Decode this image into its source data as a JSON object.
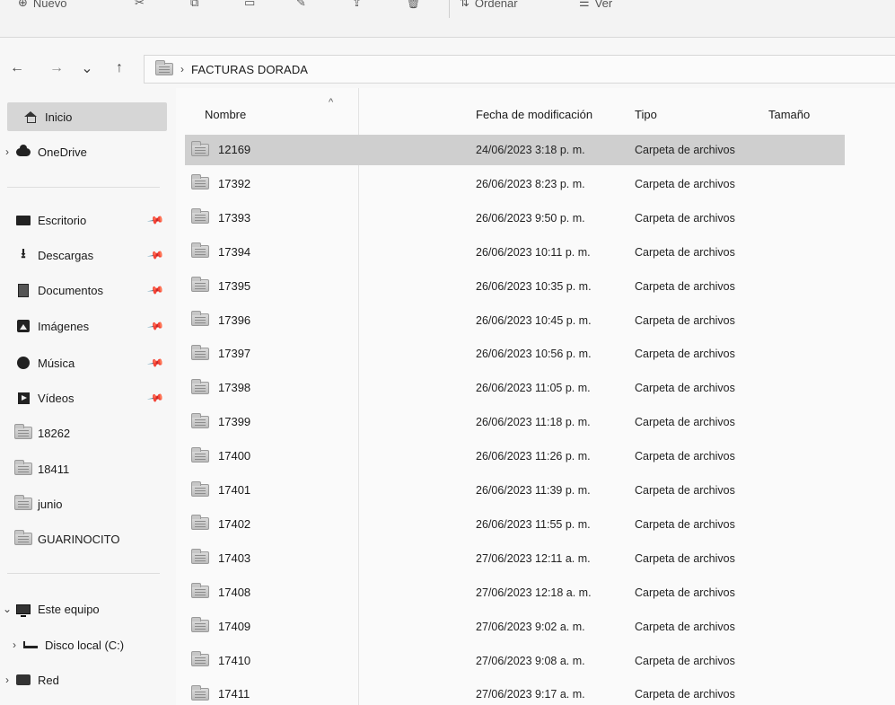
{
  "toolbar": {
    "items": [
      "Nuevo",
      "Ordenar",
      "Ver"
    ]
  },
  "nav": {
    "back": "←",
    "forward": "→",
    "recent": "⌄",
    "up": "↑"
  },
  "address": {
    "separator": "›",
    "crumb": "FACTURAS DORADA"
  },
  "sidebar": {
    "items": [
      {
        "label": "Inicio",
        "icon": "home-icon",
        "selected": true
      },
      {
        "label": "OneDrive",
        "icon": "cloud-icon",
        "chevron": "›"
      },
      {
        "label": "Escritorio",
        "icon": "desktop-icon",
        "pinned": true
      },
      {
        "label": "Descargas",
        "icon": "download-icon",
        "pinned": true
      },
      {
        "label": "Documentos",
        "icon": "document-icon",
        "pinned": true
      },
      {
        "label": "Imágenes",
        "icon": "pictures-icon",
        "pinned": true
      },
      {
        "label": "Música",
        "icon": "music-icon",
        "pinned": true
      },
      {
        "label": "Vídeos",
        "icon": "video-icon",
        "pinned": true
      },
      {
        "label": "18262",
        "icon": "folder-icon"
      },
      {
        "label": "18411",
        "icon": "folder-icon"
      },
      {
        "label": "junio",
        "icon": "folder-icon"
      },
      {
        "label": "GUARINOCITO",
        "icon": "folder-icon"
      },
      {
        "label": "Este equipo",
        "icon": "computer-icon",
        "chevron": "⌄"
      },
      {
        "label": "Disco local (C:)",
        "icon": "disk-icon",
        "chevron": "›"
      },
      {
        "label": "Red",
        "icon": "network-icon",
        "chevron": "›"
      }
    ]
  },
  "columns": {
    "name": "Nombre",
    "date": "Fecha de modificación",
    "type": "Tipo",
    "size": "Tamaño"
  },
  "files": [
    {
      "name": "12169",
      "date": "24/06/2023 3:18 p. m.",
      "type": "Carpeta de archivos",
      "selected": true
    },
    {
      "name": "17392",
      "date": "26/06/2023 8:23 p. m.",
      "type": "Carpeta de archivos"
    },
    {
      "name": "17393",
      "date": "26/06/2023 9:50 p. m.",
      "type": "Carpeta de archivos"
    },
    {
      "name": "17394",
      "date": "26/06/2023 10:11 p. m.",
      "type": "Carpeta de archivos"
    },
    {
      "name": "17395",
      "date": "26/06/2023 10:35 p. m.",
      "type": "Carpeta de archivos"
    },
    {
      "name": "17396",
      "date": "26/06/2023 10:45 p. m.",
      "type": "Carpeta de archivos"
    },
    {
      "name": "17397",
      "date": "26/06/2023 10:56 p. m.",
      "type": "Carpeta de archivos"
    },
    {
      "name": "17398",
      "date": "26/06/2023 11:05 p. m.",
      "type": "Carpeta de archivos"
    },
    {
      "name": "17399",
      "date": "26/06/2023 11:18 p. m.",
      "type": "Carpeta de archivos"
    },
    {
      "name": "17400",
      "date": "26/06/2023 11:26 p. m.",
      "type": "Carpeta de archivos"
    },
    {
      "name": "17401",
      "date": "26/06/2023 11:39 p. m.",
      "type": "Carpeta de archivos"
    },
    {
      "name": "17402",
      "date": "26/06/2023 11:55 p. m.",
      "type": "Carpeta de archivos"
    },
    {
      "name": "17403",
      "date": "27/06/2023 12:11 a. m.",
      "type": "Carpeta de archivos"
    },
    {
      "name": "17408",
      "date": "27/06/2023 12:18 a. m.",
      "type": "Carpeta de archivos"
    },
    {
      "name": "17409",
      "date": "27/06/2023 9:02 a. m.",
      "type": "Carpeta de archivos"
    },
    {
      "name": "17410",
      "date": "27/06/2023 9:08 a. m.",
      "type": "Carpeta de archivos"
    },
    {
      "name": "17411",
      "date": "27/06/2023 9:17 a. m.",
      "type": "Carpeta de archivos"
    }
  ]
}
